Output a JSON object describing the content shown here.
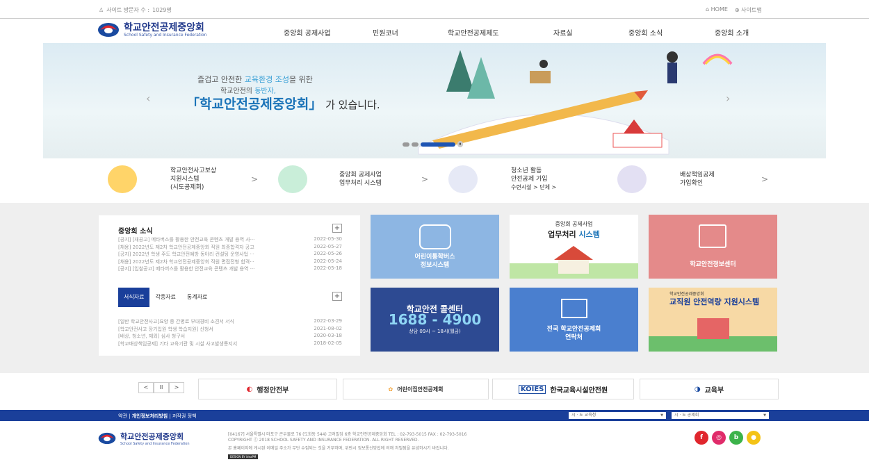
{
  "topbar": {
    "visitor_label": "사이트 방문자 수 :",
    "visitor_count": "1029명",
    "home": "HOME",
    "sitemap": "사이트맵"
  },
  "logo": {
    "name": "학교안전공제중앙회",
    "en": "School Safety and Insurance Federation"
  },
  "gnb": [
    "중앙회 공제사업",
    "민원코너",
    "학교안전공제제도",
    "자료실",
    "중앙회 소식",
    "중앙회 소개"
  ],
  "hero": {
    "line1a": "즐겁고 안전한 ",
    "line1b": "교육환경 조성",
    "line1c": "을 위한",
    "line2a": "학교안전의 ",
    "line2b": "동반자,",
    "title": "「학교안전공제중앙회」",
    "title_suffix": " 가 있습니다.",
    "prev": "‹",
    "next": "›",
    "pause": "⏸"
  },
  "quick": [
    {
      "lines": [
        "학교안전사고보상",
        "지원시스템",
        "(시도공제회)"
      ],
      "color": "#ffd469"
    },
    {
      "lines": [
        "중앙회 공제사업",
        "업무처리 시스템"
      ],
      "color": "#c9eed9"
    },
    {
      "lines": [
        "청소년 활동",
        "안전공제 가입",
        "수련시설  >     단체  >"
      ],
      "color": "#e6e9f6"
    },
    {
      "lines": [
        "배상책임공제",
        "가입확인"
      ],
      "color": "#e3e0f3"
    }
  ],
  "news": {
    "title": "중앙회 소식",
    "plus": "+",
    "items": [
      {
        "t": "[공지] [재공고] 메타버스를 활용한 안전교육 콘텐츠 개발 용역 사···",
        "d": "2022-05-30"
      },
      {
        "t": "[채용] 2022년도 제2차 학교안전공제중앙회 직원 최종합격자 공고",
        "d": "2022-05-27"
      },
      {
        "t": "[공지] 2022년 학생 주도 학교안전예방 동아리 컨설팅 운영사업 ···",
        "d": "2022-05-26"
      },
      {
        "t": "[채용] 2022년도 제2차 학교안전공제중앙회 직원 면접전형 합격···",
        "d": "2022-05-24"
      },
      {
        "t": "[공지] [입찰공고] 메타버스를 활용한 안전교육 콘텐츠 개발 용역 ···",
        "d": "2022-05-18"
      }
    ]
  },
  "docs": {
    "tabs": [
      "서식자료",
      "각종자료",
      "통계자료"
    ],
    "plus": "+",
    "items": [
      {
        "t": "[일반 학교안전사고]요양 중 간병료 부대경비 소견서 서식",
        "d": "2022-03-29"
      },
      {
        "t": "[학교안전사고 장기입원 학생 학습지원] 신청서",
        "d": "2021-08-02"
      },
      {
        "t": "[배상, 청소년, 재외] 심사 청구서",
        "d": "2020-03-18"
      },
      {
        "t": "[학교배상책임공제] 기타 교육기관 및 시설 사고발생통지서",
        "d": "2018-02-05"
      }
    ]
  },
  "tiles": {
    "bus": "어린이통학버스\n정보시스템",
    "biz_top": "중앙회 공제사업",
    "biz_main": "업무처리 ",
    "biz_accent": "시스템",
    "info": "학교안전정보센터",
    "call_title": "학교안전 콜센터",
    "call_num": "1688 - 4900",
    "call_hours": "상담 09시 ~ 18시(월금)",
    "contact": "전국 학교안전공제회\n연락처",
    "staff_small": "학교안전공제중앙회",
    "staff_title": "교직원 안전역량 지원시스템"
  },
  "banners": [
    "행정안전부",
    "어린이집안전공제회",
    "KOIES",
    "한국교육시설안전원",
    "교육부"
  ],
  "banner_sub": {
    "koies": "Korea Institute of Educational Facility Safety",
    "moe": "Ministry of Education",
    "kids": "Childcare Center Safety Insurance Association"
  },
  "ctrl": {
    "prev": "<",
    "pause": "II",
    "next": ">"
  },
  "fbar": {
    "l1": "약관",
    "l2": "개인정보처리방침",
    "l3": "저작권 정책",
    "sel1": "시 · 도 교육청",
    "sel2": "시 · 도 공제회"
  },
  "footer": {
    "addr": "[04167] 서울특별시 마포구 큰우물로 76 (도화동 544) 고려빌딩 6층 학교안전공제중앙회 TEL : 02-793-5015 FAX : 02-793-5016",
    "copy": "COPYRIGHT ⓒ 2018 SCHOOL SAFETY AND INSURANCE FEDERATION. ALL RIGHT RESERVED.",
    "note": "본 홈페이지에 게시된 이메일 주소가 무단 수집되는 것을 거부하며, 위반시 정보통신망법에 의해 처벌됨을 유념하시기 바랍니다.",
    "design": "DESIGN BY ideaPM",
    "sns": [
      "f",
      "◎",
      "b",
      "●"
    ]
  }
}
